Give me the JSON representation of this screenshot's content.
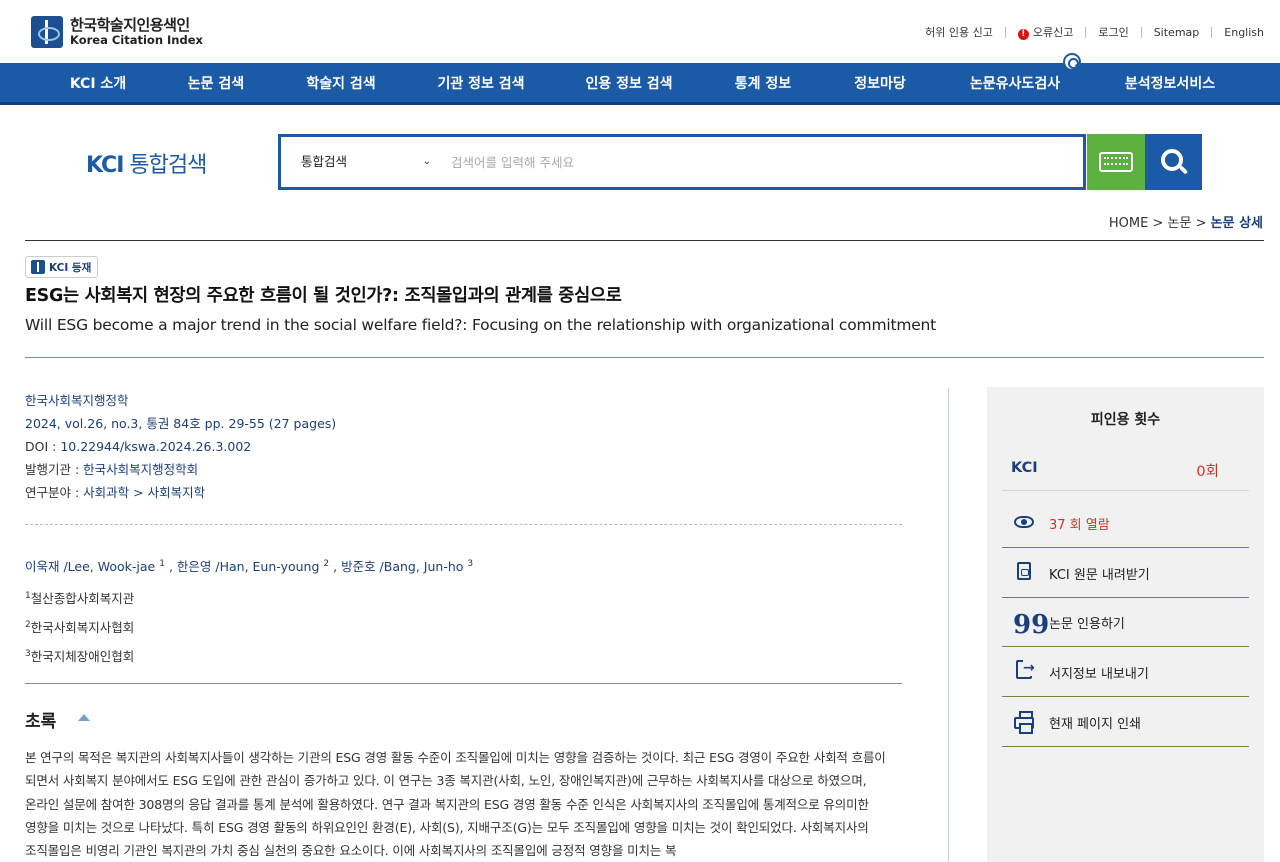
{
  "header": {
    "logo_ko": "한국학술지인용색인",
    "logo_en": "Korea Citation Index",
    "util_links": [
      "허위 인용 신고",
      "오류신고",
      "로그인",
      "Sitemap",
      "English"
    ],
    "error_icon": "!"
  },
  "nav": {
    "items": [
      "KCI 소개",
      "논문 검색",
      "학술지 검색",
      "기관 정보 검색",
      "인용 정보 검색",
      "통계 정보",
      "정보마당",
      "논문유사도검사",
      "분석정보서비스"
    ]
  },
  "search": {
    "logo_kci": "KCI",
    "logo_text": " 통합검색",
    "select_value": "통합검색",
    "chevron": "⌄",
    "placeholder": "검색어를 입력해 주세요"
  },
  "breadcrumb": {
    "home": "HOME",
    "sep": " > ",
    "section": "논문",
    "current": "논문 상세"
  },
  "article": {
    "badge": "KCI 등재",
    "title_ko": "ESG는 사회복지 현장의 주요한 흐름이 될 것인가?: 조직몰입과의 관계를 중심으로",
    "title_en": "Will ESG become a major trend in the social welfare field?: Focusing on the relationship with organizational commitment",
    "journal": "한국사회복지행정학",
    "issue": "2024, vol.26, no.3, 통권 84호 pp. 29-55 (27 pages)",
    "doi_label": "DOI : ",
    "doi": "10.22944/kswa.2024.26.3.002",
    "publisher_label": "발행기관 : ",
    "publisher": "한국사회복지행정학회",
    "field_label": "연구분야 : ",
    "field": "사회과학 > 사회복지학",
    "authors": [
      {
        "name": "이욱재 /Lee, Wook-jae",
        "sup": "1"
      },
      {
        "name": "한은영 /Han, Eun-young",
        "sup": "2"
      },
      {
        "name": "방준호 /Bang, Jun-ho",
        "sup": "3"
      }
    ],
    "affiliations": [
      {
        "sup": "1",
        "name": "철산종합사회복지관"
      },
      {
        "sup": "2",
        "name": "한국사회복지사협회"
      },
      {
        "sup": "3",
        "name": "한국지체장애인협회"
      }
    ],
    "abstract_heading": "초록",
    "abstract": "본 연구의 목적은 복지관의 사회복지사들이 생각하는 기관의 ESG 경영 활동 수준이 조직몰입에 미치는 영향을 검증하는 것이다. 최근 ESG 경영이 주요한 사회적 흐름이 되면서 사회복지 분야에서도 ESG 도입에 관한 관심이 증가하고 있다. 이 연구는 3종 복지관(사회, 노인, 장애인복지관)에 근무하는 사회복지사를 대상으로 하였으며, 온라인 설문에 참여한 308명의 응답 결과를 통계 분석에 활용하였다. 연구 결과 복지관의 ESG 경영 활동 수준 인식은 사회복지사의 조직몰입에 통계적으로 유의미한 영향을 미치는 것으로 나타났다. 특히 ESG 경영 활동의 하위요인인 환경(E), 사회(S), 지배구조(G)는 모두 조직몰입에 영향을 미치는 것이 확인되었다. 사회복지사의 조직몰입은 비영리 기관인 복지관의 가치 중심 실천의 중요한 요소이다. 이에 사회복지사의 조직몰입에 긍정적 영향을 미치는 복"
  },
  "side_panel": {
    "heading": "피인용 횟수",
    "kci_label": "KCI",
    "kci_count": "0회",
    "views": "37 회 열람",
    "actions": [
      "KCI 원문 내려받기",
      "논문 인용하기",
      "서지정보 내보내기",
      "현재 페이지 인쇄"
    ],
    "quote_glyph": "99"
  },
  "colors": {
    "brand_blue": "#1b5aa6",
    "keyboard_green": "#5bb040",
    "view_red": "#c0392b"
  }
}
